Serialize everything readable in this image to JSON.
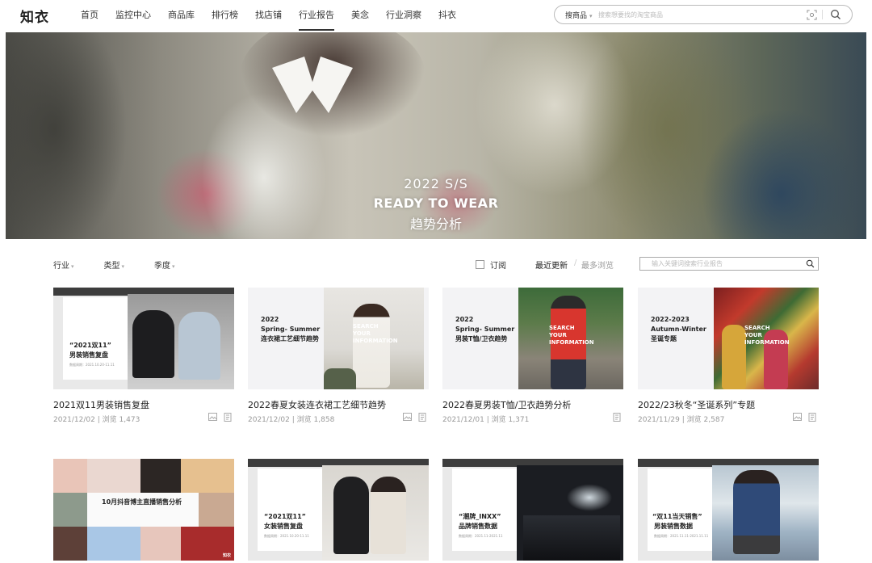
{
  "header": {
    "logo": "知衣",
    "nav": [
      {
        "label": "首页",
        "active": false
      },
      {
        "label": "监控中心",
        "active": false
      },
      {
        "label": "商品库",
        "active": false
      },
      {
        "label": "排行榜",
        "active": false
      },
      {
        "label": "找店铺",
        "active": false
      },
      {
        "label": "行业报告",
        "active": true
      },
      {
        "label": "美念",
        "active": false
      },
      {
        "label": "行业洞察",
        "active": false
      },
      {
        "label": "抖衣",
        "active": false
      }
    ],
    "search": {
      "type_label": "搜商品",
      "placeholder": "搜索想要找的淘宝商品"
    }
  },
  "banner": {
    "line1": "2022 S/S",
    "line2": "READY TO WEAR",
    "line3": "趋势分析"
  },
  "filters": {
    "industry": "行业",
    "type": "类型",
    "season": "季度",
    "subscribe": "订阅",
    "sort_recent": "最近更新",
    "sort_views": "最多浏览",
    "search_placeholder": "输入关键词搜索行业报告"
  },
  "cards": [
    {
      "title": "2021双11男装销售复盘",
      "date": "2021/12/02",
      "views_label": "浏览",
      "views": "1,473",
      "thumb_title": "“2021双11”",
      "thumb_subtitle": "男装销售复盘",
      "thumb_small": "数据周期：2021.10.20-11.11"
    },
    {
      "title": "2022春夏女装连衣裙工艺细节趋势",
      "date": "2021/12/02",
      "views_label": "浏览",
      "views": "1,858",
      "thumb_year": "2022",
      "thumb_season": "Spring- Summer",
      "thumb_subtitle": "连衣裙工艺细节趋势",
      "thumb_overlay": "SEARCH\nYOUR\nINFORMATION"
    },
    {
      "title": "2022春夏男装T恤/卫衣趋势分析",
      "date": "2021/12/01",
      "views_label": "浏览",
      "views": "1,371",
      "thumb_year": "2022",
      "thumb_season": "Spring- Summer",
      "thumb_subtitle": "男装T恤/卫衣趋势",
      "thumb_overlay": "SEARCH\nYOUR\nINFORMATION"
    },
    {
      "title": "2022/23秋冬“圣诞系列”专题",
      "date": "2021/11/29",
      "views_label": "浏览",
      "views": "2,587",
      "thumb_year": "2022-2023",
      "thumb_season": "Autumn-Winter",
      "thumb_subtitle": "圣诞专题",
      "thumb_overlay": "SEARCH\nYOUR\nINFORMATION"
    },
    {
      "thumb_subtitle": "10月抖音博主直播销售分析",
      "thumb_mark": "知衣"
    },
    {
      "thumb_title": "“2021双11”",
      "thumb_subtitle": "女装销售复盘",
      "thumb_small": "数据周期：2021.10.20-11.11"
    },
    {
      "thumb_title": "“潮牌_INXX”",
      "thumb_subtitle": "品牌销售数据",
      "thumb_small": "数据周期：2021.11-2021.11"
    },
    {
      "thumb_title": "“双11当天销售”",
      "thumb_subtitle": "男装销售数据",
      "thumb_small": "数据周期：2021.11.11-2021.11.11"
    }
  ],
  "colors": {
    "accent_red": "#e84a3c",
    "text_dark": "#222222",
    "text_muted": "#999999"
  }
}
